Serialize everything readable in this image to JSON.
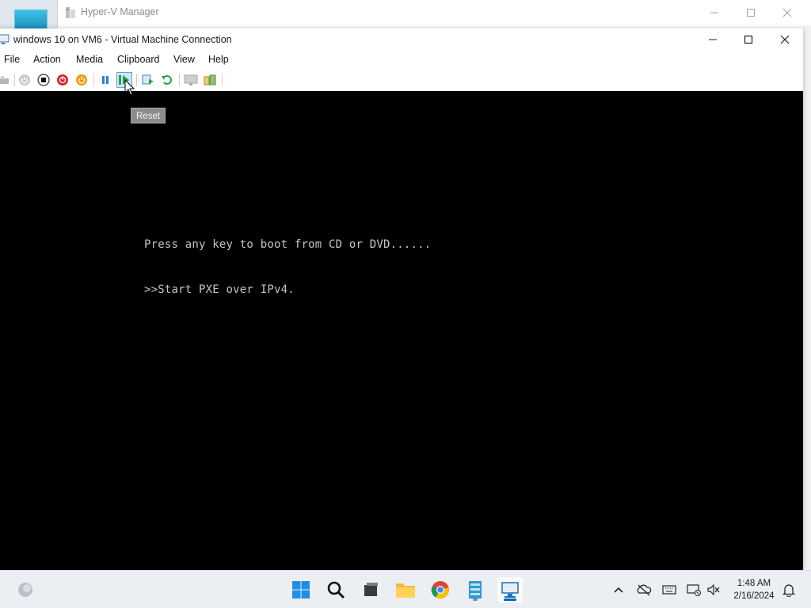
{
  "background_window": {
    "title": "Hyper-V Manager",
    "controls": [
      "minimize",
      "maximize",
      "close"
    ]
  },
  "vm_window": {
    "title": "windows 10 on VM6 - Virtual Machine Connection",
    "menu": [
      "File",
      "Action",
      "Media",
      "Clipboard",
      "View",
      "Help"
    ],
    "toolbar": [
      "ctrl-alt-del-icon",
      "start-icon",
      "turn-off-icon",
      "shut-down-icon",
      "save-icon",
      "pause-icon",
      "reset-icon",
      "checkpoint-icon",
      "revert-icon",
      "enhanced-session-icon",
      "share-icon"
    ],
    "tooltip": "Reset",
    "console_lines": [
      "Press any key to boot from CD or DVD......",
      ">>Start PXE over IPv4."
    ]
  },
  "taskbar": {
    "apps": [
      "widgets",
      "start",
      "search",
      "task-view",
      "file-explorer",
      "chrome",
      "server-manager",
      "hyper-v-manager"
    ],
    "active_app": "hyper-v-manager",
    "time": "1:48 AM",
    "date": "2/16/2024"
  },
  "colors": {
    "console_bg": "#000000",
    "console_text": "#c4c4c4",
    "accent": "#0067c0",
    "taskbar_bg": "#ebeef2"
  }
}
